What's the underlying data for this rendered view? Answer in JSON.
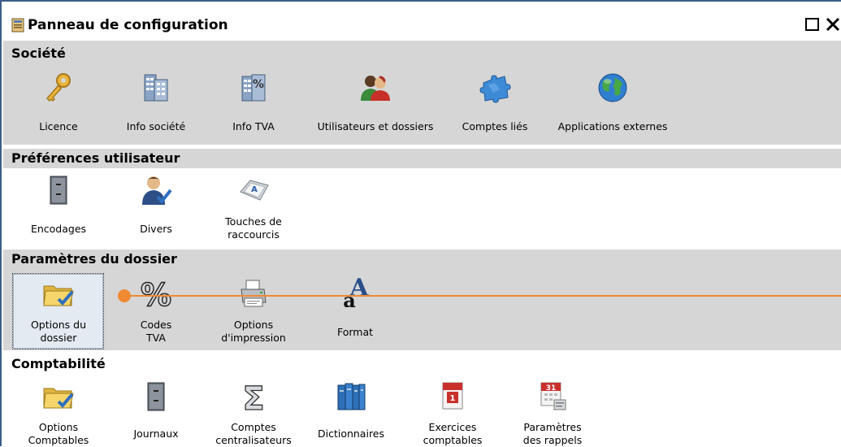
{
  "window": {
    "title": "Panneau de configuration"
  },
  "sections": {
    "societe": {
      "title": "Société",
      "items": {
        "licence": "Licence",
        "info_societe": "Info société",
        "info_tva": "Info TVA",
        "utilisateurs": "Utilisateurs et dossiers",
        "comptes_lies": "Comptes liés",
        "applications": "Applications externes"
      }
    },
    "preferences": {
      "title": "Préférences utilisateur",
      "items": {
        "encodages": "Encodages",
        "divers": "Divers",
        "touches_1": "Touches de",
        "touches_2": "raccourcis"
      }
    },
    "parametres": {
      "title": "Paramètres du dossier",
      "items": {
        "options_1": "Options du",
        "options_2": "dossier",
        "codes_1": "Codes",
        "codes_2": "TVA",
        "impression_1": "Options",
        "impression_2": "d'impression",
        "format": "Format"
      }
    },
    "comptabilite": {
      "title": "Comptabilité",
      "items": {
        "opt_compt_1": "Options",
        "opt_compt_2": "Comptables",
        "journaux": "Journaux",
        "centr_1": "Comptes",
        "centr_2": "centralisateurs",
        "dictionnaires": "Dictionnaires",
        "exercices_1": "Exercices",
        "exercices_2": "comptables",
        "rappels_1": "Paramètres",
        "rappels_2": "des rappels"
      }
    }
  },
  "icon_text": {
    "percent": "%",
    "format_big": "A",
    "format_small": "a",
    "calendar_1": "1",
    "calendar_31": "31",
    "sigma": "Σ"
  },
  "colors": {
    "section_band": "#d6d6d6",
    "annotation": "#f08a33",
    "window_border": "#3a5f86"
  }
}
